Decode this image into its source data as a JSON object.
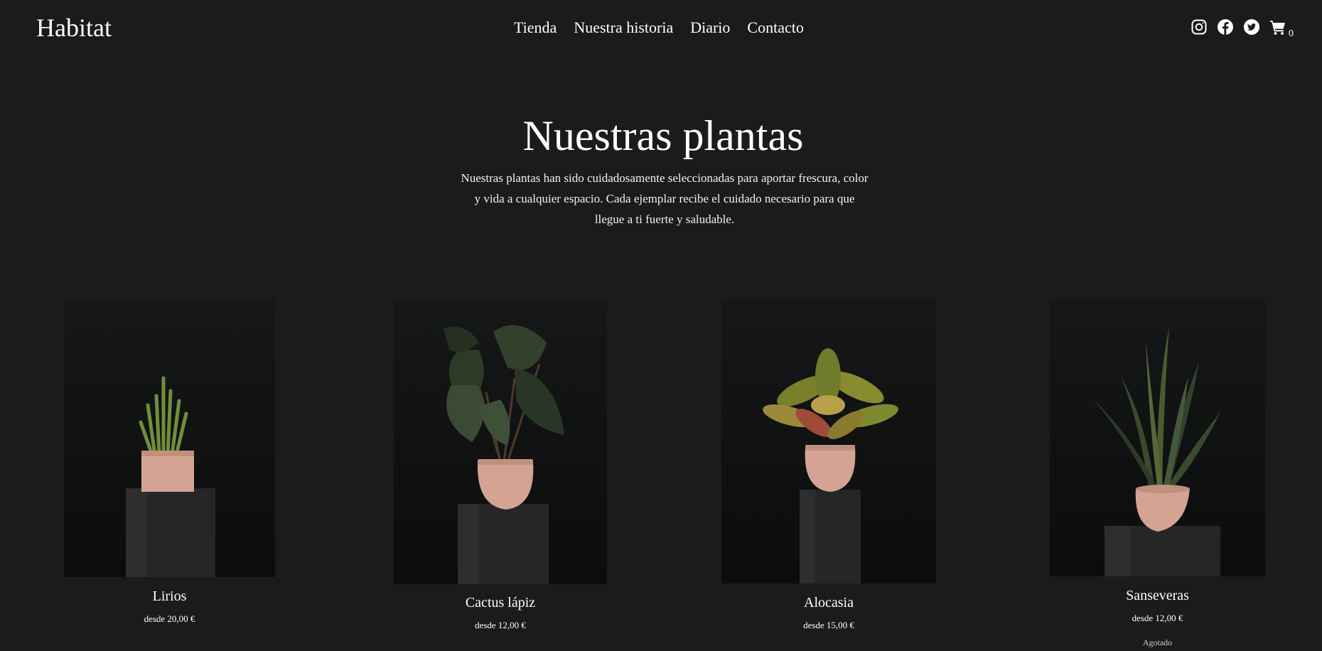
{
  "header": {
    "logo": "Habitat",
    "nav": [
      "Tienda",
      "Nuestra historia",
      "Diario",
      "Contacto"
    ],
    "social_icons": [
      "instagram-icon",
      "facebook-icon",
      "twitter-icon"
    ],
    "cart_icon": "cart-icon",
    "cart_count": "0"
  },
  "hero": {
    "title": "Nuestras plantas",
    "description": "Nuestras plantas han sido cuidadosamente seleccionadas para aportar frescura, color y vida a cualquier espacio. Cada ejemplar recibe el cuidado necesario para que llegue a ti fuerte y saludable."
  },
  "products": [
    {
      "name": "Lirios",
      "price": "desde 20,00 €",
      "status": ""
    },
    {
      "name": "Cactus lápiz",
      "price": "desde 12,00 €",
      "status": ""
    },
    {
      "name": "Alocasia",
      "price": "desde 15,00 €",
      "status": ""
    },
    {
      "name": "Sanseveras",
      "price": "desde 12,00 €",
      "status": "Agotado"
    }
  ],
  "colors": {
    "background": "#1b1b1b",
    "text": "#ffffff",
    "pot": "#d6a79b",
    "pedestal": "#2a2b2c"
  }
}
